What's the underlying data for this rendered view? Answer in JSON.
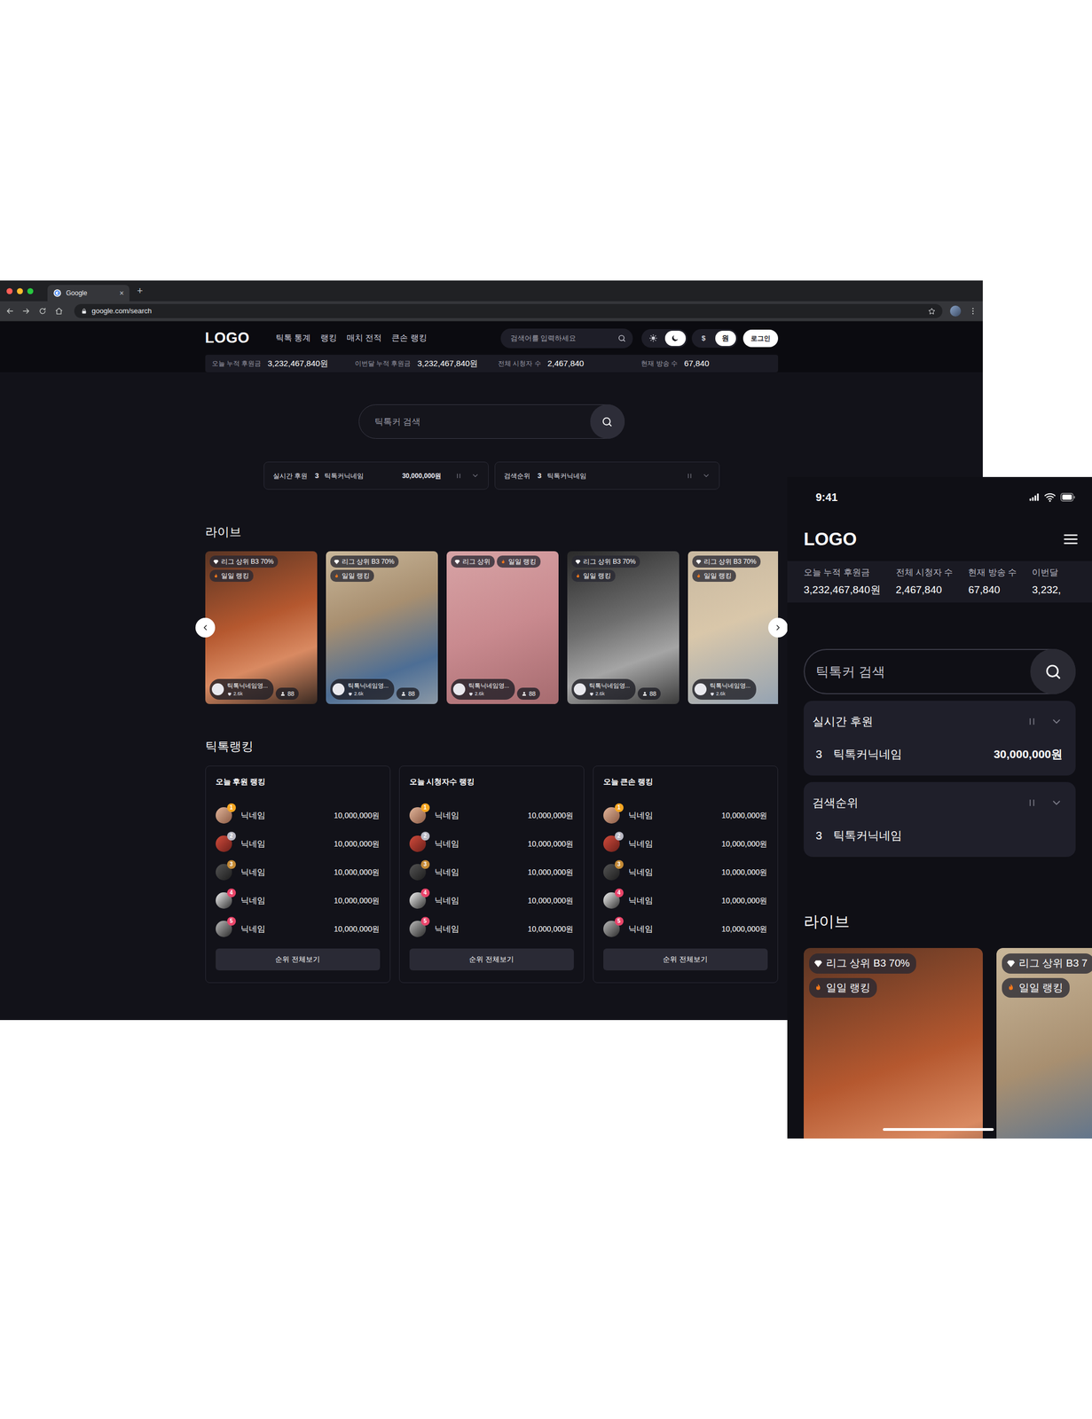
{
  "browser": {
    "tab": {
      "title": "Google",
      "close": "×"
    },
    "new_tab": "+",
    "url": "google.com/search"
  },
  "desktop": {
    "logo": "LOGO",
    "nav": [
      "틱톡 통계",
      "랭킹",
      "매치 전적",
      "큰손 랭킹"
    ],
    "search": {
      "placeholder": "검색어를 입력하세요"
    },
    "theme": [
      {
        "selected": false
      },
      {
        "selected": true
      }
    ],
    "currency": [
      {
        "label": "$",
        "selected": false
      },
      {
        "label": "원",
        "selected": true
      }
    ],
    "login": "로그인",
    "stats": [
      {
        "label": "오늘 누적 후원금",
        "value": "3,232,467,840원"
      },
      {
        "label": "이번달 누적 후원금",
        "value": "3,232,467,840원"
      },
      {
        "label": "전체 시청자 수",
        "value": "2,467,840"
      },
      {
        "label": "현재 방송 수",
        "value": "67,840"
      }
    ],
    "hero_search": {
      "placeholder": "틱톡커 검색"
    },
    "tickers": [
      {
        "title": "실시간 후원",
        "rank": "3",
        "name": "틱톡커닉네임",
        "amount": "30,000,000원"
      },
      {
        "title": "검색순위",
        "rank": "3",
        "name": "틱톡커닉네임"
      }
    ],
    "live": {
      "title": "라이브",
      "cards": [
        {
          "tags": [
            {
              "label": "리그 상위 B3 70%",
              "kind": "league"
            },
            {
              "label": "일일 랭킹",
              "kind": "daily"
            }
          ],
          "name": "틱톡닉네임영...",
          "likes": "2.6k",
          "viewers": "88"
        },
        {
          "tags": [
            {
              "label": "리그 상위 B3 70%",
              "kind": "league"
            },
            {
              "label": "일일 랭킹",
              "kind": "daily"
            }
          ],
          "name": "틱톡닉네임영...",
          "likes": "2.6k",
          "viewers": "88"
        },
        {
          "tags": [
            {
              "label": "리그 상위",
              "kind": "league"
            },
            {
              "label": "일일 랭킹",
              "kind": "daily"
            }
          ],
          "name": "틱톡닉네임영...",
          "likes": "2.6k",
          "viewers": "88"
        },
        {
          "tags": [
            {
              "label": "리그 상위 B3 70%",
              "kind": "league"
            },
            {
              "label": "일일 랭킹",
              "kind": "daily"
            }
          ],
          "name": "틱톡닉네임영...",
          "likes": "2.6k",
          "viewers": "88"
        },
        {
          "tags": [
            {
              "label": "리그 상위 B3 70%",
              "kind": "league"
            },
            {
              "label": "일일 랭킹",
              "kind": "daily"
            }
          ],
          "name": "틱톡닉네임영...",
          "likes": "2.6k"
        }
      ]
    },
    "ranking": {
      "title": "틱톡랭킹",
      "panels": [
        {
          "title": "오늘 후원 랭킹",
          "button": "순위 전체보기",
          "rows": [
            {
              "rank": "1",
              "name": "닉네임",
              "value": "10,000,000원",
              "color": "#f5a623"
            },
            {
              "rank": "2",
              "name": "닉네임",
              "value": "10,000,000원",
              "color": "#b9b9c4"
            },
            {
              "rank": "3",
              "name": "닉네임",
              "value": "10,000,000원",
              "color": "#c48a36"
            },
            {
              "rank": "4",
              "name": "닉네임",
              "value": "10,000,000원",
              "color": "#e9456a"
            },
            {
              "rank": "5",
              "name": "닉네임",
              "value": "10,000,000원",
              "color": "#e9456a"
            }
          ]
        },
        {
          "title": "오늘 시청자수 랭킹",
          "button": "순위 전체보기",
          "rows": [
            {
              "rank": "1",
              "name": "닉네임",
              "value": "10,000,000원",
              "color": "#f5a623"
            },
            {
              "rank": "2",
              "name": "닉네임",
              "value": "10,000,000원",
              "color": "#b9b9c4"
            },
            {
              "rank": "3",
              "name": "닉네임",
              "value": "10,000,000원",
              "color": "#c48a36"
            },
            {
              "rank": "4",
              "name": "닉네임",
              "value": "10,000,000원",
              "color": "#e9456a"
            },
            {
              "rank": "5",
              "name": "닉네임",
              "value": "10,000,000원",
              "color": "#e9456a"
            }
          ]
        },
        {
          "title": "오늘 큰손 랭킹",
          "button": "순위 전체보기",
          "rows": [
            {
              "rank": "1",
              "name": "닉네임",
              "value": "10,000,000원",
              "color": "#f5a623"
            },
            {
              "rank": "2",
              "name": "닉네임",
              "value": "10,000,000원",
              "color": "#b9b9c4"
            },
            {
              "rank": "3",
              "name": "닉네임",
              "value": "10,000,000원",
              "color": "#c48a36"
            },
            {
              "rank": "4",
              "name": "닉네임",
              "value": "10,000,000원",
              "color": "#e9456a"
            },
            {
              "rank": "5",
              "name": "닉네임",
              "value": "10,000,000원",
              "color": "#e9456a"
            }
          ]
        }
      ]
    }
  },
  "mobile": {
    "time": "9:41",
    "logo": "LOGO",
    "stats": [
      {
        "label": "오늘 누적 후원금",
        "value": "3,232,467,840원"
      },
      {
        "label": "전체 시청자 수",
        "value": "2,467,840"
      },
      {
        "label": "현재 방송 수",
        "value": "67,840"
      },
      {
        "label": "이번달",
        "value": "3,232,"
      }
    ],
    "search": {
      "placeholder": "틱톡커 검색"
    },
    "tickers": [
      {
        "title": "실시간 후원",
        "rank": "3",
        "name": "틱톡커닉네임",
        "amount": "30,000,000원"
      },
      {
        "title": "검색순위",
        "rank": "3",
        "name": "틱톡커닉네임"
      }
    ],
    "live": {
      "title": "라이브",
      "cards": [
        {
          "tags": [
            {
              "label": "리그 상위 B3 70%",
              "kind": "league"
            },
            {
              "label": "일일 랭킹",
              "kind": "daily"
            }
          ]
        },
        {
          "tags": [
            {
              "label": "리그 상위 B3 7",
              "kind": "league"
            },
            {
              "label": "일일 랭킹",
              "kind": "daily"
            }
          ]
        }
      ]
    }
  }
}
